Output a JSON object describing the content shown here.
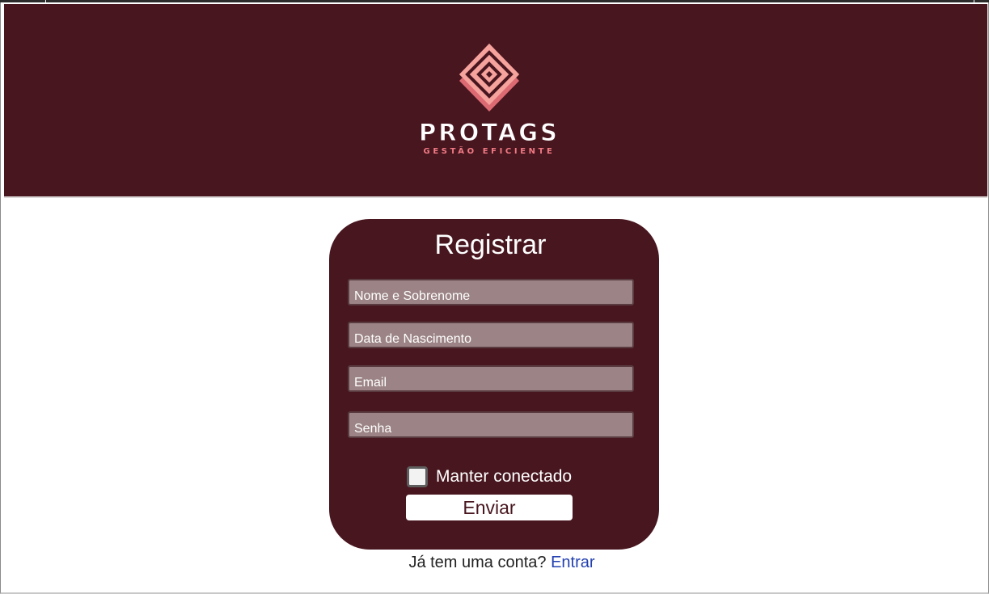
{
  "brand": {
    "name": "PROTAGS",
    "tagline": "GESTÃO EFICIENTE",
    "colors": {
      "background": "#48161f",
      "logo_light": "#f4a09a",
      "logo_mid": "#e56f78",
      "tagline": "#f07a84"
    }
  },
  "form": {
    "title": "Registrar",
    "fields": [
      {
        "name": "full-name",
        "placeholder": "Nome e Sobrenome",
        "value": ""
      },
      {
        "name": "birth-date",
        "placeholder": "Data de Nascimento",
        "value": ""
      },
      {
        "name": "email",
        "placeholder": "Email",
        "value": ""
      },
      {
        "name": "password",
        "placeholder": "Senha",
        "value": ""
      }
    ],
    "remember_label": "Manter conectado",
    "remember_checked": false,
    "submit_label": "Enviar"
  },
  "login": {
    "prompt": "Já tem uma conta?",
    "link_label": "Entrar"
  },
  "theme": {
    "primary": "#48161f",
    "field_bg": "#9c8486",
    "link": "#2340b0"
  }
}
